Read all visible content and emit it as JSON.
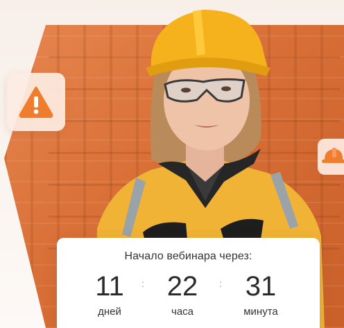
{
  "countdown": {
    "heading": "Начало вебинара через:",
    "separator": ":",
    "days": {
      "value": "11",
      "label": "дней"
    },
    "hours": {
      "value": "22",
      "label": "часа"
    },
    "minutes": {
      "value": "31",
      "label": "минута"
    }
  },
  "icons": {
    "badge_left": "warning-icon",
    "badge_right": "hard-hat-icon"
  },
  "colors": {
    "accent": "#f07d2e",
    "hexagon": "#d86f37",
    "helmet": "#f5b21d",
    "jacket": "#f0b335"
  }
}
